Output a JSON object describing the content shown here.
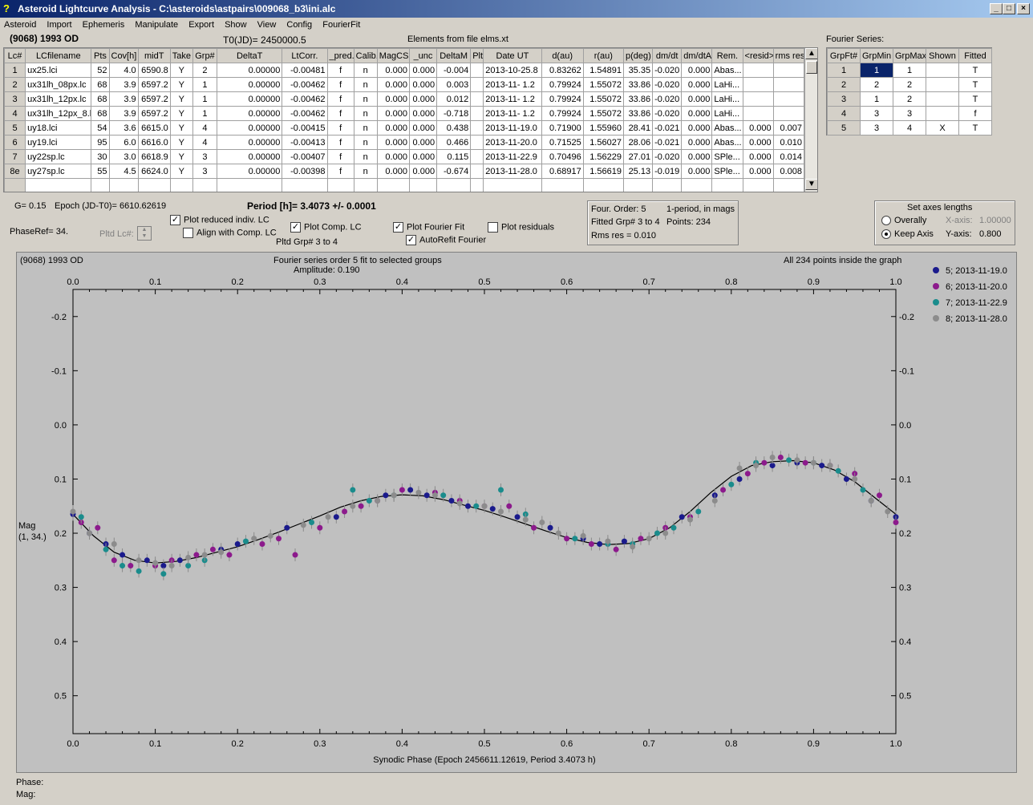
{
  "window": {
    "title": "Asteroid Lightcurve Analysis - C:\\asteroids\\astpairs\\009068_b3\\ini.alc",
    "icon": "app-icon",
    "buttons": [
      "_",
      "□",
      "×"
    ]
  },
  "menu": [
    "Asteroid",
    "Import",
    "Ephemeris",
    "Manipulate",
    "Export",
    "Show",
    "View",
    "Config",
    "FourierFit"
  ],
  "header": {
    "asteroid": "(9068)  1993 OD",
    "t0": "T0(JD)= 2450000.5",
    "elements": "Elements from file elms.xt"
  },
  "lc_table": {
    "columns": [
      "Lc#",
      "LCfilename",
      "Pts",
      "Cov[h]",
      "midT",
      "Take",
      "Grp#",
      "DeltaT",
      "LtCorr.",
      "_pred.",
      "Calib.",
      "MagCS",
      "_unc",
      "DeltaM",
      "Plt",
      "Date UT",
      "d(au)",
      "r(au)",
      "p(deg)",
      "dm/dt",
      "dm/dtA",
      "Rem.",
      "<resid>",
      "rms res"
    ],
    "rows": [
      [
        "1",
        "ux25.lci",
        "52",
        "4.0",
        "6590.8",
        "Y",
        "2",
        "0.00000",
        "-0.00481",
        "f",
        "n",
        "0.000",
        "0.000",
        "-0.004",
        "",
        "2013-10-25.8",
        "0.83262",
        "1.54891",
        "35.35",
        "-0.020",
        "0.000",
        "Abas...",
        "",
        ""
      ],
      [
        "2",
        "ux31lh_08px.lc",
        "68",
        "3.9",
        "6597.2",
        "Y",
        "1",
        "0.00000",
        "-0.00462",
        "f",
        "n",
        "0.000",
        "0.000",
        "0.003",
        "",
        "2013-11- 1.2",
        "0.79924",
        "1.55072",
        "33.86",
        "-0.020",
        "0.000",
        "LaHi...",
        "",
        ""
      ],
      [
        "3",
        "ux31lh_12px.lc",
        "68",
        "3.9",
        "6597.2",
        "Y",
        "1",
        "0.00000",
        "-0.00462",
        "f",
        "n",
        "0.000",
        "0.000",
        "0.012",
        "",
        "2013-11- 1.2",
        "0.79924",
        "1.55072",
        "33.86",
        "-0.020",
        "0.000",
        "LaHi...",
        "",
        ""
      ],
      [
        "4",
        "ux31lh_12px_8.l",
        "68",
        "3.9",
        "6597.2",
        "Y",
        "1",
        "0.00000",
        "-0.00462",
        "f",
        "n",
        "0.000",
        "0.000",
        "-0.718",
        "",
        "2013-11- 1.2",
        "0.79924",
        "1.55072",
        "33.86",
        "-0.020",
        "0.000",
        "LaHi...",
        "",
        ""
      ],
      [
        "5",
        "uy18.lci",
        "54",
        "3.6",
        "6615.0",
        "Y",
        "4",
        "0.00000",
        "-0.00415",
        "f",
        "n",
        "0.000",
        "0.000",
        "0.438",
        "",
        "2013-11-19.0",
        "0.71900",
        "1.55960",
        "28.41",
        "-0.021",
        "0.000",
        "Abas...",
        "0.000",
        "0.007"
      ],
      [
        "6",
        "uy19.lci",
        "95",
        "6.0",
        "6616.0",
        "Y",
        "4",
        "0.00000",
        "-0.00413",
        "f",
        "n",
        "0.000",
        "0.000",
        "0.466",
        "",
        "2013-11-20.0",
        "0.71525",
        "1.56027",
        "28.06",
        "-0.021",
        "0.000",
        "Abas...",
        "0.000",
        "0.010"
      ],
      [
        "7",
        "uy22sp.lc",
        "30",
        "3.0",
        "6618.9",
        "Y",
        "3",
        "0.00000",
        "-0.00407",
        "f",
        "n",
        "0.000",
        "0.000",
        "0.115",
        "",
        "2013-11-22.9",
        "0.70496",
        "1.56229",
        "27.01",
        "-0.020",
        "0.000",
        "SPle...",
        "0.000",
        "0.014"
      ],
      [
        "8e",
        "uy27sp.lc",
        "55",
        "4.5",
        "6624.0",
        "Y",
        "3",
        "0.00000",
        "-0.00398",
        "f",
        "n",
        "0.000",
        "0.000",
        "-0.674",
        "",
        "2013-11-28.0",
        "0.68917",
        "1.56619",
        "25.13",
        "-0.019",
        "0.000",
        "SPle...",
        "0.000",
        "0.008"
      ]
    ]
  },
  "fourier_table": {
    "title": "Fourier Series:",
    "columns": [
      "GrpFt#",
      "GrpMin",
      "GrpMax",
      "Shown",
      "Fitted"
    ],
    "rows": [
      [
        "1",
        "1",
        "1",
        "",
        "T"
      ],
      [
        "2",
        "2",
        "2",
        "",
        "T"
      ],
      [
        "3",
        "1",
        "2",
        "",
        "T"
      ],
      [
        "4",
        "3",
        "3",
        "",
        "f"
      ],
      [
        "5",
        "3",
        "4",
        "X",
        "T"
      ]
    ]
  },
  "controls": {
    "g": "G= 0.15",
    "epoch": "Epoch (JD-T0)= 6610.62619",
    "period": "Period [h]= 3.4073 +/- 0.0001",
    "phaseref": "PhaseRef= 34.",
    "pltd_lc": "Pltd Lc#:",
    "plot_reduced": "Plot reduced indiv. LC",
    "align_comp": "Align with Comp. LC",
    "plot_comp": "Plot Comp. LC",
    "pltd_grp": "Pltd Grp#  3  to  4",
    "plot_fourier": "Plot Fourier Fit",
    "autorefit": "AutoRefit Fourier",
    "plot_resid": "Plot residuals",
    "four_order": "Four. Order:  5",
    "one_period": "1-period, in mags",
    "fitted_grp": "Fitted Grp# 3 to 4",
    "points": "Points: 234",
    "rms": "Rms res     = 0.010",
    "axes_title": "Set axes lengths",
    "overally": "Overally",
    "keep_axis": "Keep Axis",
    "xaxis_label": "X-axis:",
    "xaxis_val": "1.00000",
    "yaxis_label": "Y-axis:",
    "yaxis_val": "0.800"
  },
  "plot_header": {
    "left": "(9068) 1993 OD",
    "center1": "Fourier series order 5 fit to selected groups",
    "center2": "Amplitude: 0.190",
    "right": "All 234 points inside the graph"
  },
  "legend_colors": {
    "5": "#1a1a8c",
    "6": "#8c1a8c",
    "7": "#1a8c8c",
    "8": "#8c8c8c"
  },
  "chart_data": {
    "type": "scatter",
    "xlabel": "Synodic Phase (Epoch 2456611.12619, Period 3.4073 h)",
    "ylabel": "Mag",
    "ylabel2": "(1, 34.)",
    "xlim": [
      0.0,
      1.0
    ],
    "ylim": [
      -0.25,
      0.57
    ],
    "y_inverted": true,
    "xticks": [
      "0.0",
      "0.1",
      "0.2",
      "0.3",
      "0.4",
      "0.5",
      "0.6",
      "0.7",
      "0.8",
      "0.9",
      "1.0"
    ],
    "yticks": [
      "-0.2",
      "-0.1",
      "0.0",
      "0.1",
      "0.2",
      "0.3",
      "0.4",
      "0.5"
    ],
    "yticks_left": [
      "-0.2",
      "-0.1",
      "0.0",
      "0.1",
      "0.2",
      "0.3",
      "0.4",
      "0.5"
    ],
    "yticks_right": [
      "-0.2",
      "-0.1",
      "0.0",
      "0.1",
      "0.2",
      "0.3",
      "0.4",
      "0.5"
    ],
    "series": [
      {
        "name": "5; 2013-11-19.0",
        "x": [
          0.0,
          0.02,
          0.04,
          0.06,
          0.09,
          0.11,
          0.13,
          0.18,
          0.2,
          0.26,
          0.32,
          0.38,
          0.41,
          0.43,
          0.46,
          0.48,
          0.51,
          0.54,
          0.58,
          0.62,
          0.64,
          0.67,
          0.74,
          0.78,
          0.81,
          0.85,
          0.88,
          0.91,
          0.94,
          0.97,
          1.0
        ],
        "y": [
          0.165,
          0.2,
          0.22,
          0.24,
          0.25,
          0.26,
          0.25,
          0.23,
          0.22,
          0.19,
          0.17,
          0.13,
          0.12,
          0.13,
          0.14,
          0.15,
          0.155,
          0.17,
          0.19,
          0.21,
          0.22,
          0.215,
          0.17,
          0.13,
          0.1,
          0.075,
          0.07,
          0.075,
          0.1,
          0.14,
          0.17
        ]
      },
      {
        "name": "6; 2013-11-20.0",
        "x": [
          0.01,
          0.03,
          0.05,
          0.07,
          0.1,
          0.12,
          0.15,
          0.17,
          0.19,
          0.23,
          0.25,
          0.27,
          0.3,
          0.33,
          0.35,
          0.37,
          0.4,
          0.44,
          0.47,
          0.5,
          0.53,
          0.56,
          0.6,
          0.63,
          0.66,
          0.69,
          0.72,
          0.75,
          0.79,
          0.82,
          0.84,
          0.86,
          0.89,
          0.92,
          0.95,
          0.98,
          1.0
        ],
        "y": [
          0.18,
          0.19,
          0.25,
          0.26,
          0.26,
          0.25,
          0.24,
          0.23,
          0.24,
          0.22,
          0.21,
          0.24,
          0.19,
          0.16,
          0.15,
          0.14,
          0.12,
          0.125,
          0.14,
          0.15,
          0.15,
          0.19,
          0.21,
          0.22,
          0.23,
          0.21,
          0.19,
          0.17,
          0.12,
          0.09,
          0.07,
          0.06,
          0.07,
          0.075,
          0.09,
          0.13,
          0.18
        ]
      },
      {
        "name": "7; 2013-11-22.9",
        "x": [
          0.01,
          0.04,
          0.06,
          0.08,
          0.11,
          0.14,
          0.16,
          0.21,
          0.29,
          0.34,
          0.36,
          0.39,
          0.45,
          0.49,
          0.52,
          0.55,
          0.61,
          0.65,
          0.68,
          0.71,
          0.73,
          0.76,
          0.8,
          0.83,
          0.87,
          0.9,
          0.93,
          0.96
        ],
        "y": [
          0.17,
          0.23,
          0.26,
          0.27,
          0.275,
          0.26,
          0.25,
          0.215,
          0.18,
          0.12,
          0.14,
          0.13,
          0.13,
          0.15,
          0.12,
          0.165,
          0.21,
          0.22,
          0.22,
          0.2,
          0.19,
          0.16,
          0.11,
          0.07,
          0.065,
          0.07,
          0.085,
          0.12
        ]
      },
      {
        "name": "8; 2013-11-28.0",
        "x": [
          0.0,
          0.02,
          0.05,
          0.08,
          0.1,
          0.12,
          0.14,
          0.16,
          0.18,
          0.22,
          0.24,
          0.28,
          0.31,
          0.34,
          0.37,
          0.39,
          0.42,
          0.44,
          0.47,
          0.5,
          0.52,
          0.55,
          0.57,
          0.59,
          0.62,
          0.65,
          0.68,
          0.7,
          0.72,
          0.75,
          0.78,
          0.81,
          0.83,
          0.85,
          0.88,
          0.9,
          0.92,
          0.95,
          0.97,
          0.99
        ],
        "y": [
          0.16,
          0.2,
          0.22,
          0.25,
          0.255,
          0.26,
          0.245,
          0.24,
          0.235,
          0.21,
          0.205,
          0.185,
          0.17,
          0.15,
          0.14,
          0.13,
          0.125,
          0.13,
          0.145,
          0.15,
          0.16,
          0.175,
          0.18,
          0.2,
          0.205,
          0.215,
          0.225,
          0.21,
          0.2,
          0.175,
          0.14,
          0.08,
          0.075,
          0.06,
          0.065,
          0.07,
          0.075,
          0.1,
          0.14,
          0.16
        ]
      }
    ],
    "fit": {
      "x": [
        0.0,
        0.025,
        0.05,
        0.075,
        0.1,
        0.125,
        0.15,
        0.175,
        0.2,
        0.225,
        0.25,
        0.275,
        0.3,
        0.325,
        0.35,
        0.375,
        0.4,
        0.425,
        0.45,
        0.475,
        0.5,
        0.525,
        0.55,
        0.575,
        0.6,
        0.625,
        0.65,
        0.675,
        0.7,
        0.725,
        0.75,
        0.775,
        0.8,
        0.825,
        0.85,
        0.875,
        0.9,
        0.925,
        0.95,
        0.975,
        1.0
      ],
      "y": [
        0.165,
        0.205,
        0.235,
        0.25,
        0.255,
        0.252,
        0.245,
        0.235,
        0.225,
        0.212,
        0.198,
        0.183,
        0.168,
        0.152,
        0.14,
        0.132,
        0.129,
        0.131,
        0.138,
        0.148,
        0.158,
        0.17,
        0.183,
        0.196,
        0.208,
        0.217,
        0.221,
        0.219,
        0.21,
        0.19,
        0.16,
        0.125,
        0.095,
        0.075,
        0.068,
        0.066,
        0.07,
        0.083,
        0.105,
        0.135,
        0.165
      ]
    }
  },
  "status": {
    "phase": "Phase:",
    "mag": "Mag:"
  }
}
